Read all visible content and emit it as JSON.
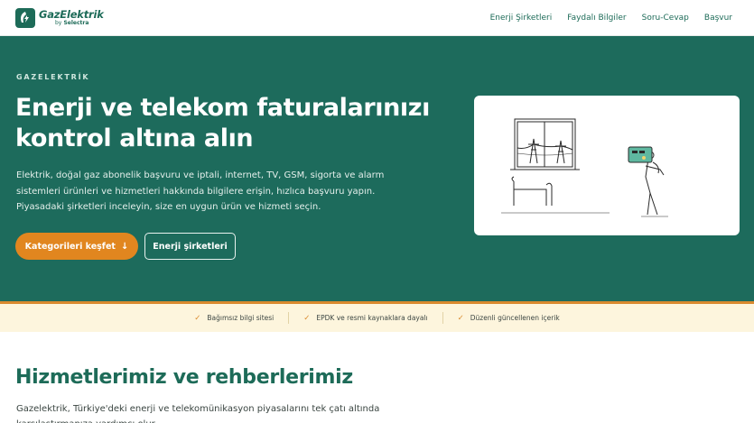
{
  "header": {
    "logo_name": "GazElektrik",
    "logo_by_prefix": "by",
    "logo_by_brand": "Selectra",
    "nav": [
      {
        "label": "Enerji Şirketleri"
      },
      {
        "label": "Faydalı Bilgiler"
      },
      {
        "label": "Soru-Cevap"
      },
      {
        "label": "Başvur"
      }
    ]
  },
  "hero": {
    "eyebrow": "GAZELEKTRİK",
    "title": "Enerji ve telekom faturalarınızı kontrol altına alın",
    "description": "Elektrik, doğal gaz abonelik başvuru ve iptali, internet, TV, GSM, sigorta ve alarm sistemleri ürünleri ve hizmetleri hakkında bilgilere erişin, hızlıca başvuru yapın. Piyasadaki şirketleri inceleyin, size en uygun ürün ve hizmeti seçin.",
    "primary_button": "Kategorileri keşfet",
    "secondary_button": "Enerji şirketleri"
  },
  "trust": [
    {
      "label": "Bağımsız bilgi sitesi"
    },
    {
      "label": "EPDK ve resmi kaynaklara dayalı"
    },
    {
      "label": "Düzenli güncellenen içerik"
    }
  ],
  "services": {
    "title": "Hizmetlerimiz ve rehberlerimiz",
    "description": "Gazelektrik, Türkiye'deki enerji ve telekomünikasyon piyasalarını tek çatı altında karşılaştırmanıza yardımcı olur."
  },
  "colors": {
    "brand_green": "#1d6b5c",
    "accent_orange": "#e1861f",
    "trust_bg": "#fdf5dd"
  },
  "icons": {
    "logo": "leaf-bolt-icon",
    "arrow": "arrow-down-icon",
    "check": "check-icon"
  }
}
